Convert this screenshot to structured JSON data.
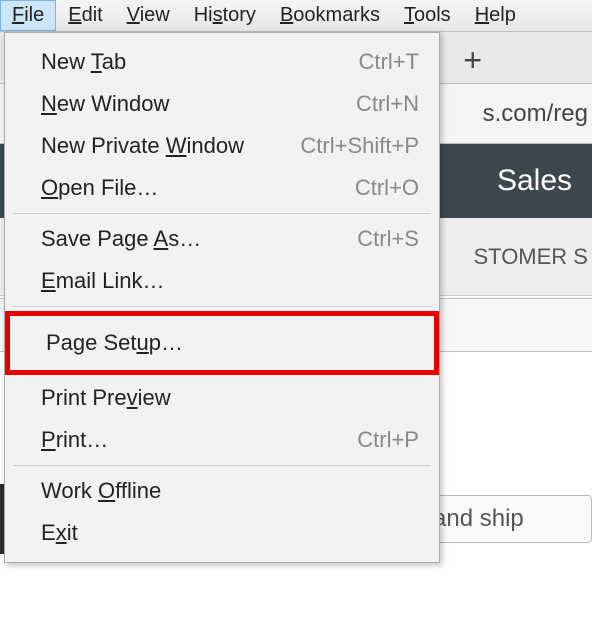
{
  "menubar": {
    "items": [
      {
        "pre": "",
        "u": "F",
        "post": "ile",
        "active": true
      },
      {
        "pre": "",
        "u": "E",
        "post": "dit"
      },
      {
        "pre": "",
        "u": "V",
        "post": "iew"
      },
      {
        "pre": "Hi",
        "u": "s",
        "post": "tory"
      },
      {
        "pre": "",
        "u": "B",
        "post": "ookmarks"
      },
      {
        "pre": "",
        "u": "T",
        "post": "ools"
      },
      {
        "pre": "",
        "u": "H",
        "post": "elp"
      }
    ]
  },
  "dropdown": {
    "group1": [
      {
        "pre": "New ",
        "u": "T",
        "post": "ab",
        "shortcut": "Ctrl+T"
      },
      {
        "pre": "",
        "u": "N",
        "post": "ew Window",
        "shortcut": "Ctrl+N"
      },
      {
        "pre": "New Private ",
        "u": "W",
        "post": "indow",
        "shortcut": "Ctrl+Shift+P"
      },
      {
        "pre": "",
        "u": "O",
        "post": "pen File…",
        "shortcut": "Ctrl+O"
      }
    ],
    "group2": [
      {
        "pre": "Save Page ",
        "u": "A",
        "post": "s…",
        "shortcut": "Ctrl+S"
      },
      {
        "pre": "",
        "u": "E",
        "post": "mail Link…",
        "shortcut": ""
      }
    ],
    "highlighted": {
      "pre": "Page Set",
      "u": "u",
      "post": "p…",
      "shortcut": ""
    },
    "group3": [
      {
        "pre": "Print Pre",
        "u": "v",
        "post": "iew",
        "shortcut": ""
      },
      {
        "pre": "",
        "u": "P",
        "post": "rint…",
        "shortcut": "Ctrl+P"
      }
    ],
    "group4": [
      {
        "pre": "Work ",
        "u": "O",
        "post": "ffline",
        "shortcut": ""
      },
      {
        "pre": "E",
        "u": "x",
        "post": "it",
        "shortcut": ""
      }
    ]
  },
  "bg": {
    "tab_plus": "+",
    "addr_fragment": "s.com/reg",
    "band1": "Sales",
    "customer_fragment": "STOMER S",
    "sales_side": "Sales",
    "ship_text": "item and ship"
  }
}
